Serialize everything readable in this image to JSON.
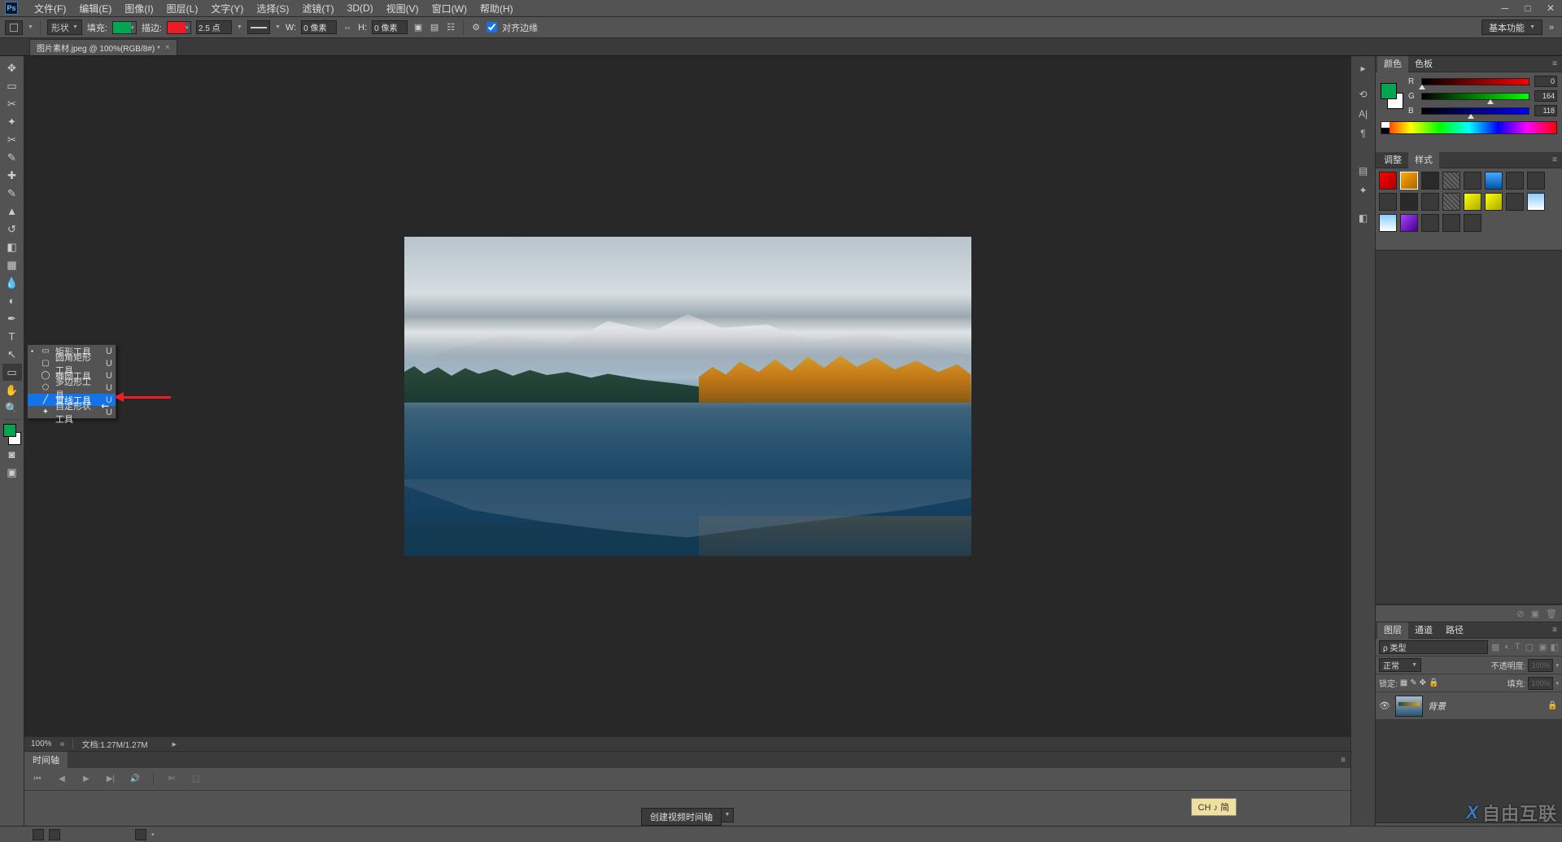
{
  "document": {
    "tab_title": "图片素材.jpeg @ 100%(RGB/8#) *",
    "zoom": "100%",
    "filesize": "文档:1.27M/1.27M"
  },
  "menubar": {
    "items": [
      "文件(F)",
      "编辑(E)",
      "图像(I)",
      "图层(L)",
      "文字(Y)",
      "选择(S)",
      "滤镜(T)",
      "3D(D)",
      "视图(V)",
      "窗口(W)",
      "帮助(H)"
    ]
  },
  "optionsbar": {
    "mode_label": "形状",
    "fill_label": "填充:",
    "stroke_label": "描边:",
    "stroke_width": "2.5 点",
    "w_label": "W:",
    "w_value": "0 像素",
    "h_label": "H:",
    "h_value": "0 像素",
    "align_edges": "对齐边缘",
    "basic_functions": "基本功能",
    "fill_color": "#00a651",
    "stroke_color": "#ed1c24"
  },
  "shape_flyout": {
    "items": [
      {
        "label": "矩形工具",
        "shortcut": "U"
      },
      {
        "label": "圆角矩形工具",
        "shortcut": "U"
      },
      {
        "label": "椭圆工具",
        "shortcut": "U"
      },
      {
        "label": "多边形工具",
        "shortcut": "U"
      },
      {
        "label": "直线工具",
        "shortcut": "U"
      },
      {
        "label": "自定形状工具",
        "shortcut": "U"
      }
    ],
    "selected_index": 0,
    "highlighted_index": 4
  },
  "color_panel": {
    "tab_color": "颜色",
    "tab_swatches": "色板",
    "r": 0,
    "g": 164,
    "b": 118,
    "foreground": "#00a476",
    "background": "#ffffff"
  },
  "adjustments_panel": {
    "tab_adjust": "调整",
    "tab_styles": "样式"
  },
  "layers_panel": {
    "tab_layers": "图层",
    "tab_channels": "通道",
    "tab_paths": "路径",
    "kind_label": "类型",
    "filter_placeholder": "ρ 类型",
    "blend_mode": "正常",
    "opacity_label": "不透明度:",
    "opacity_value": "100%",
    "lock_label": "锁定:",
    "fill_label": "填充:",
    "fill_value": "100%",
    "layers": [
      {
        "name": "背景",
        "locked": true
      }
    ]
  },
  "timeline": {
    "tab_label": "时间轴",
    "create_button": "创建视频时间轴"
  },
  "ime": {
    "text": "CH ♪ 简"
  },
  "watermark": "自由互联"
}
